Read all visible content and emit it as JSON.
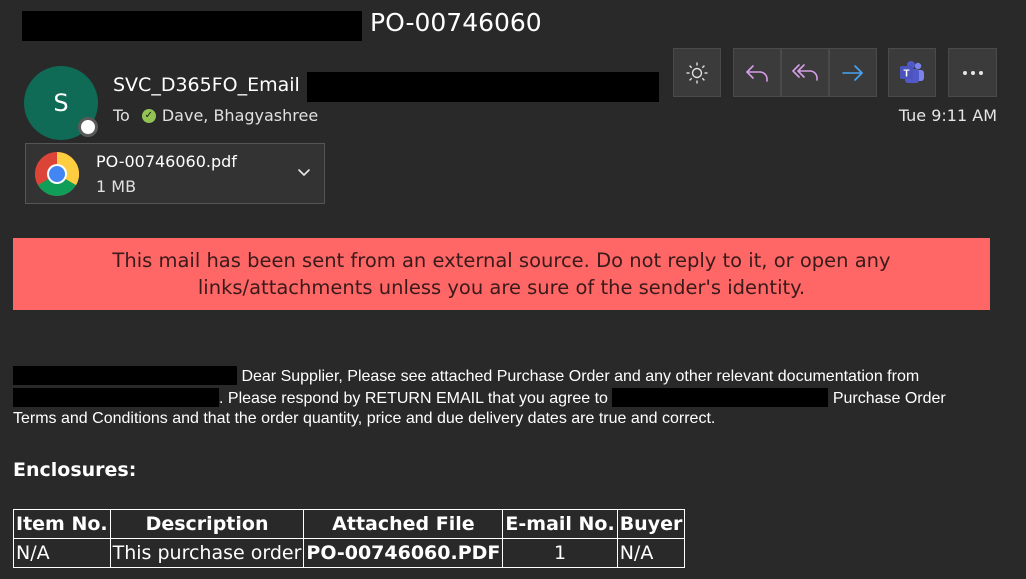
{
  "header": {
    "subject": "PO-00746060"
  },
  "sender": {
    "avatar_initial": "S",
    "name": "SVC_D365FO_Email",
    "to_label": "To",
    "recipient": "Dave, Bhagyashree",
    "timestamp": "Tue 9:11 AM"
  },
  "toolbar": {
    "icons": [
      "sun-icon",
      "reply-icon",
      "reply-all-icon",
      "forward-icon",
      "teams-icon",
      "more-icon"
    ]
  },
  "attachment": {
    "filename": "PO-00746060.pdf",
    "size": "1 MB"
  },
  "banner": {
    "text": "This mail has been sent from an external source. Do not reply to it, or open any links/attachments unless you are sure of the sender's identity.",
    "color": "#ff6666"
  },
  "body": {
    "part1": " Dear Supplier, Please see attached Purchase Order and any other relevant documentation from ",
    "part2": ". Please respond by RETURN EMAIL that you agree to ",
    "part3": " Purchase Order Terms and Conditions and that the order quantity, price and due delivery dates are true and correct."
  },
  "enclosures": {
    "heading": "Enclosures:",
    "columns": [
      "Item No.",
      "Description",
      "Attached File",
      "E-mail No.",
      "Buyer"
    ],
    "row": {
      "item_no": "N/A",
      "description": "This purchase order",
      "attached_file": "PO-00746060.PDF",
      "email_no": "1",
      "buyer": "N/A"
    }
  }
}
